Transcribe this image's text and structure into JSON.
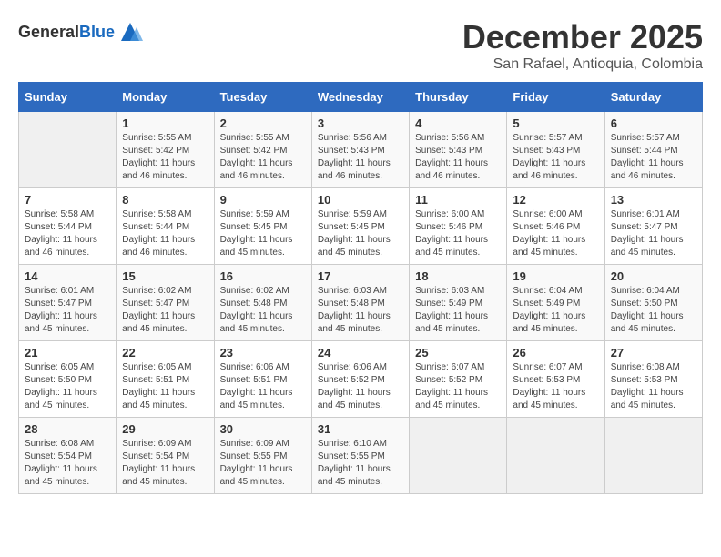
{
  "header": {
    "logo_general": "General",
    "logo_blue": "Blue",
    "month": "December 2025",
    "location": "San Rafael, Antioquia, Colombia"
  },
  "days_of_week": [
    "Sunday",
    "Monday",
    "Tuesday",
    "Wednesday",
    "Thursday",
    "Friday",
    "Saturday"
  ],
  "weeks": [
    [
      {
        "day": "",
        "info": ""
      },
      {
        "day": "1",
        "info": "Sunrise: 5:55 AM\nSunset: 5:42 PM\nDaylight: 11 hours\nand 46 minutes."
      },
      {
        "day": "2",
        "info": "Sunrise: 5:55 AM\nSunset: 5:42 PM\nDaylight: 11 hours\nand 46 minutes."
      },
      {
        "day": "3",
        "info": "Sunrise: 5:56 AM\nSunset: 5:43 PM\nDaylight: 11 hours\nand 46 minutes."
      },
      {
        "day": "4",
        "info": "Sunrise: 5:56 AM\nSunset: 5:43 PM\nDaylight: 11 hours\nand 46 minutes."
      },
      {
        "day": "5",
        "info": "Sunrise: 5:57 AM\nSunset: 5:43 PM\nDaylight: 11 hours\nand 46 minutes."
      },
      {
        "day": "6",
        "info": "Sunrise: 5:57 AM\nSunset: 5:44 PM\nDaylight: 11 hours\nand 46 minutes."
      }
    ],
    [
      {
        "day": "7",
        "info": "Sunrise: 5:58 AM\nSunset: 5:44 PM\nDaylight: 11 hours\nand 46 minutes."
      },
      {
        "day": "8",
        "info": "Sunrise: 5:58 AM\nSunset: 5:44 PM\nDaylight: 11 hours\nand 46 minutes."
      },
      {
        "day": "9",
        "info": "Sunrise: 5:59 AM\nSunset: 5:45 PM\nDaylight: 11 hours\nand 45 minutes."
      },
      {
        "day": "10",
        "info": "Sunrise: 5:59 AM\nSunset: 5:45 PM\nDaylight: 11 hours\nand 45 minutes."
      },
      {
        "day": "11",
        "info": "Sunrise: 6:00 AM\nSunset: 5:46 PM\nDaylight: 11 hours\nand 45 minutes."
      },
      {
        "day": "12",
        "info": "Sunrise: 6:00 AM\nSunset: 5:46 PM\nDaylight: 11 hours\nand 45 minutes."
      },
      {
        "day": "13",
        "info": "Sunrise: 6:01 AM\nSunset: 5:47 PM\nDaylight: 11 hours\nand 45 minutes."
      }
    ],
    [
      {
        "day": "14",
        "info": "Sunrise: 6:01 AM\nSunset: 5:47 PM\nDaylight: 11 hours\nand 45 minutes."
      },
      {
        "day": "15",
        "info": "Sunrise: 6:02 AM\nSunset: 5:47 PM\nDaylight: 11 hours\nand 45 minutes."
      },
      {
        "day": "16",
        "info": "Sunrise: 6:02 AM\nSunset: 5:48 PM\nDaylight: 11 hours\nand 45 minutes."
      },
      {
        "day": "17",
        "info": "Sunrise: 6:03 AM\nSunset: 5:48 PM\nDaylight: 11 hours\nand 45 minutes."
      },
      {
        "day": "18",
        "info": "Sunrise: 6:03 AM\nSunset: 5:49 PM\nDaylight: 11 hours\nand 45 minutes."
      },
      {
        "day": "19",
        "info": "Sunrise: 6:04 AM\nSunset: 5:49 PM\nDaylight: 11 hours\nand 45 minutes."
      },
      {
        "day": "20",
        "info": "Sunrise: 6:04 AM\nSunset: 5:50 PM\nDaylight: 11 hours\nand 45 minutes."
      }
    ],
    [
      {
        "day": "21",
        "info": "Sunrise: 6:05 AM\nSunset: 5:50 PM\nDaylight: 11 hours\nand 45 minutes."
      },
      {
        "day": "22",
        "info": "Sunrise: 6:05 AM\nSunset: 5:51 PM\nDaylight: 11 hours\nand 45 minutes."
      },
      {
        "day": "23",
        "info": "Sunrise: 6:06 AM\nSunset: 5:51 PM\nDaylight: 11 hours\nand 45 minutes."
      },
      {
        "day": "24",
        "info": "Sunrise: 6:06 AM\nSunset: 5:52 PM\nDaylight: 11 hours\nand 45 minutes."
      },
      {
        "day": "25",
        "info": "Sunrise: 6:07 AM\nSunset: 5:52 PM\nDaylight: 11 hours\nand 45 minutes."
      },
      {
        "day": "26",
        "info": "Sunrise: 6:07 AM\nSunset: 5:53 PM\nDaylight: 11 hours\nand 45 minutes."
      },
      {
        "day": "27",
        "info": "Sunrise: 6:08 AM\nSunset: 5:53 PM\nDaylight: 11 hours\nand 45 minutes."
      }
    ],
    [
      {
        "day": "28",
        "info": "Sunrise: 6:08 AM\nSunset: 5:54 PM\nDaylight: 11 hours\nand 45 minutes."
      },
      {
        "day": "29",
        "info": "Sunrise: 6:09 AM\nSunset: 5:54 PM\nDaylight: 11 hours\nand 45 minutes."
      },
      {
        "day": "30",
        "info": "Sunrise: 6:09 AM\nSunset: 5:55 PM\nDaylight: 11 hours\nand 45 minutes."
      },
      {
        "day": "31",
        "info": "Sunrise: 6:10 AM\nSunset: 5:55 PM\nDaylight: 11 hours\nand 45 minutes."
      },
      {
        "day": "",
        "info": ""
      },
      {
        "day": "",
        "info": ""
      },
      {
        "day": "",
        "info": ""
      }
    ]
  ]
}
